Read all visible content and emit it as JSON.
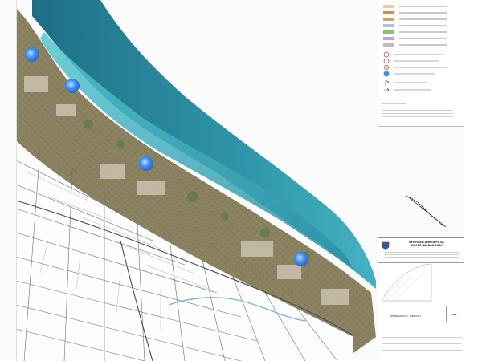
{
  "map": {
    "base_color": "#fbfbfb",
    "sea_color_deep": "#1f6f86",
    "sea_color_shallow": "#45b2c2",
    "land_color": "#8a7f60",
    "cadastral_line_color": "#6e6e6e",
    "river_color": "#7fb4d6"
  },
  "markers": [
    {
      "name": "beach-point-1"
    },
    {
      "name": "beach-point-2"
    },
    {
      "name": "beach-point-3"
    },
    {
      "name": "beach-point-4"
    }
  ],
  "legend": {
    "swatch_colors": [
      "#f2c7a4",
      "#d98a4a",
      "#c7a85e",
      "#9ec7e6",
      "#8cc06e",
      "#b7a9cf",
      "#bfbfbf"
    ],
    "symbol_icons": [
      "circle-arrow-icon",
      "circle-arrow-icon",
      "pink-circle-icon",
      "blue-dot-icon",
      "flag-icon",
      "arrow-icon"
    ]
  },
  "titleblock": {
    "logo_icon": "municipality-seal-icon",
    "header_lines": [
      "ΚΥΠΡΙΑΚΗ ΔΗΜΟΚΡΑΤΙΑ",
      "ΔΗΜΟΣ ΠΑΡΑΛΙΜΝΙΟΥ"
    ],
    "drawing_title": "ΓΕΝΙΚΗ ΔΙΑΤΑΞΗ - ΠΙΝΑΚΑΣ 1",
    "sheet_label": "Α/1"
  }
}
